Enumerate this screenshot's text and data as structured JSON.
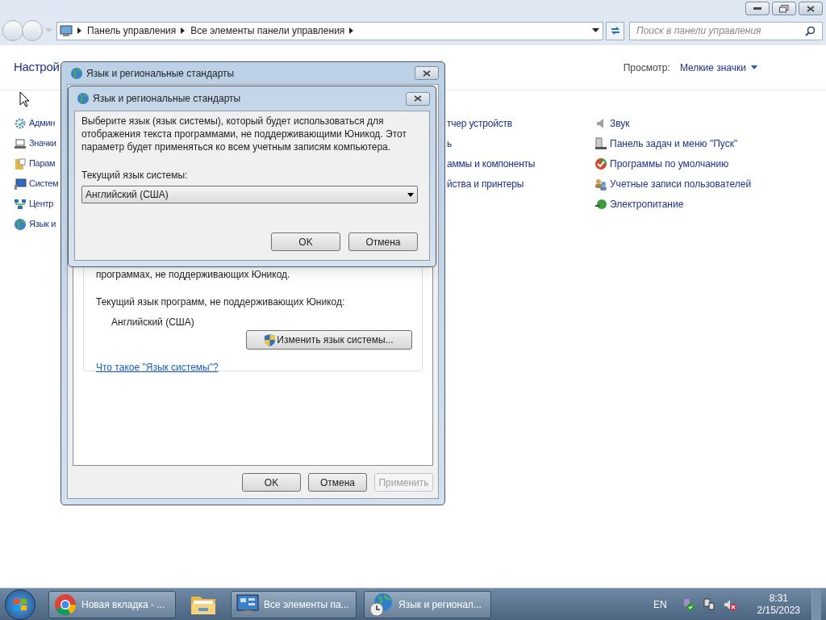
{
  "explorer": {
    "breadcrumb": [
      "Панель управления",
      "Все элементы панели управления"
    ],
    "search": {
      "placeholder": "Поиск в панели управления"
    },
    "heading": "Настрой",
    "view_label": "Просмотр:",
    "view_value": "Мелкие значки",
    "items_left": [
      "Админ",
      "Значки",
      "Парам",
      "Систем",
      "Центр",
      "Язык и"
    ],
    "items_middle": [
      "тчер устройств",
      "ь",
      "аммы и компоненты",
      "йства и принтеры"
    ],
    "items_right": [
      "Звук",
      "Панель задач и меню \"Пуск\"",
      "Программы по умолчанию",
      "Учетные записи пользователей",
      "Электропитание"
    ]
  },
  "region_dialog": {
    "title": "Язык и региональные стандарты",
    "group_text": "программах, не поддерживающих Юникод.",
    "current_label": "Текущий язык программ, не поддерживающих Юникод:",
    "current_value": "Английский (США)",
    "change_button": "Изменить язык системы...",
    "link": "Что такое \"Язык системы\"?",
    "buttons": [
      {
        "label": "OK",
        "disabled": false
      },
      {
        "label": "Отмена",
        "disabled": false
      },
      {
        "label": "Применить",
        "disabled": true
      }
    ]
  },
  "system_locale_dialog": {
    "title": "Язык и региональные стандарты",
    "description": "Выберите язык (язык системы), который будет использоваться для отображения текста программами, не поддерживающими Юникод. Этот параметр будет применяться ко всем учетным записям компьютера.",
    "label": "Текущий язык системы:",
    "select_value": "Английский (США)",
    "buttons": [
      "OK",
      "Отмена"
    ]
  },
  "taskbar": {
    "buttons": [
      "Новая вкладка - ...",
      "Все элементы па...",
      "Язык и регионал..."
    ],
    "language": "EN",
    "time": "8:31",
    "date": "2/15/2023"
  }
}
